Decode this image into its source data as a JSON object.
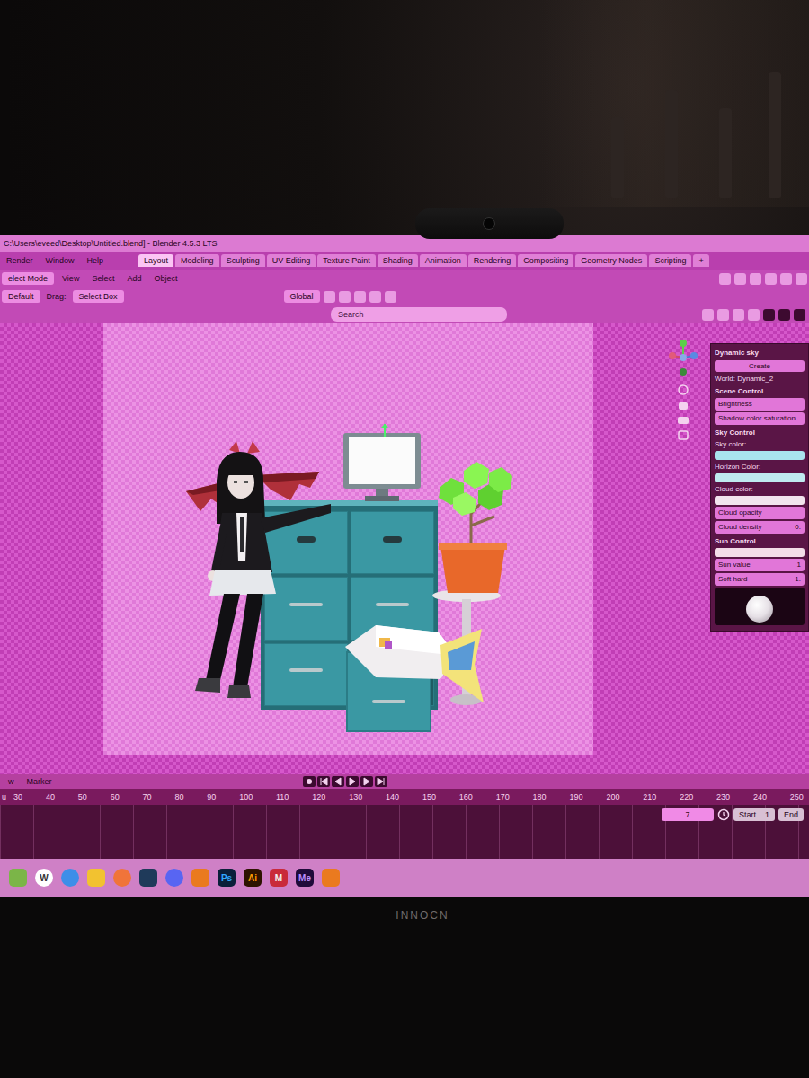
{
  "window": {
    "title": "C:\\Users\\eveed\\Desktop\\Untitled.blend] - Blender 4.5.3 LTS"
  },
  "menu": [
    "Render",
    "Window",
    "Help"
  ],
  "workspace_tabs": [
    {
      "label": "Layout",
      "selected": true
    },
    {
      "label": "Modeling",
      "selected": false
    },
    {
      "label": "Sculpting",
      "selected": false
    },
    {
      "label": "UV Editing",
      "selected": false
    },
    {
      "label": "Texture Paint",
      "selected": false
    },
    {
      "label": "Shading",
      "selected": false
    },
    {
      "label": "Animation",
      "selected": false
    },
    {
      "label": "Rendering",
      "selected": false
    },
    {
      "label": "Compositing",
      "selected": false
    },
    {
      "label": "Geometry Nodes",
      "selected": false
    },
    {
      "label": "Scripting",
      "selected": false
    },
    {
      "label": "+",
      "selected": false
    }
  ],
  "toolbar": {
    "mode": "elect Mode",
    "menus": [
      "View",
      "Select",
      "Add",
      "Object"
    ],
    "orientation": "Default",
    "drag_label": "Drag:",
    "drag_value": "Select Box",
    "transform": "Global"
  },
  "viewport_header": {
    "search_placeholder": "Search"
  },
  "dynamic_sky": {
    "title": "Dynamic sky",
    "button": "Create",
    "world": "World: Dynamic_2",
    "rows": [
      {
        "kind": "heading",
        "label": "Scene Control"
      },
      {
        "kind": "field",
        "label": "Brightness",
        "value": ""
      },
      {
        "kind": "field",
        "label": "Shadow color saturation",
        "value": ""
      },
      {
        "kind": "heading",
        "label": "Sky Control"
      },
      {
        "kind": "label",
        "label": "Sky color:"
      },
      {
        "kind": "swatch",
        "color": "#a9e3ee"
      },
      {
        "kind": "label",
        "label": "Horizon Color:"
      },
      {
        "kind": "swatch",
        "color": "#bfeaf0"
      },
      {
        "kind": "label",
        "label": "Cloud color:"
      },
      {
        "kind": "swatch",
        "color": "#f2e4ee"
      },
      {
        "kind": "field",
        "label": "Cloud opacity",
        "value": ""
      },
      {
        "kind": "field",
        "label": "Cloud density",
        "value": "0."
      },
      {
        "kind": "heading",
        "label": "Sun Control"
      },
      {
        "kind": "swatch",
        "color": "#f3dde8"
      },
      {
        "kind": "field",
        "label": "Sun value",
        "value": "1"
      },
      {
        "kind": "field",
        "label": "Soft hard",
        "value": "1."
      },
      {
        "kind": "preview"
      }
    ]
  },
  "timeline": {
    "menus": [
      "w",
      "Marker"
    ],
    "left_label": "u",
    "ticks": [
      "30",
      "40",
      "50",
      "60",
      "70",
      "80",
      "90",
      "100",
      "110",
      "120",
      "130",
      "140",
      "150",
      "160",
      "170",
      "180",
      "190",
      "200",
      "210",
      "220",
      "230",
      "240",
      "250"
    ],
    "current_frame": "7",
    "start_label": "Start",
    "start": "1",
    "end_label": "End"
  },
  "taskbar": [
    {
      "kind": "app",
      "color": "#7bb548"
    },
    {
      "kind": "letter",
      "label": "W",
      "color": "#ffffff"
    },
    {
      "kind": "app",
      "color": "#3d8ee8"
    },
    {
      "kind": "app",
      "color": "#f2c230"
    },
    {
      "kind": "app",
      "color": "#f0743a"
    },
    {
      "kind": "app",
      "color": "#1f3a5a"
    },
    {
      "kind": "app",
      "color": "#5865f2"
    },
    {
      "kind": "app",
      "color": "#ea7a1f"
    },
    {
      "kind": "letter",
      "label": "Ps",
      "color": "#0b1f3a"
    },
    {
      "kind": "letter",
      "label": "Ai",
      "color": "#2e1300"
    },
    {
      "kind": "letter",
      "label": "M",
      "color": "#c92a3a"
    },
    {
      "kind": "letter",
      "label": "Me",
      "color": "#1f0a3a"
    },
    {
      "kind": "app",
      "color": "#ea7a1f"
    }
  ],
  "monitor": {
    "brand": "INNOCN"
  }
}
